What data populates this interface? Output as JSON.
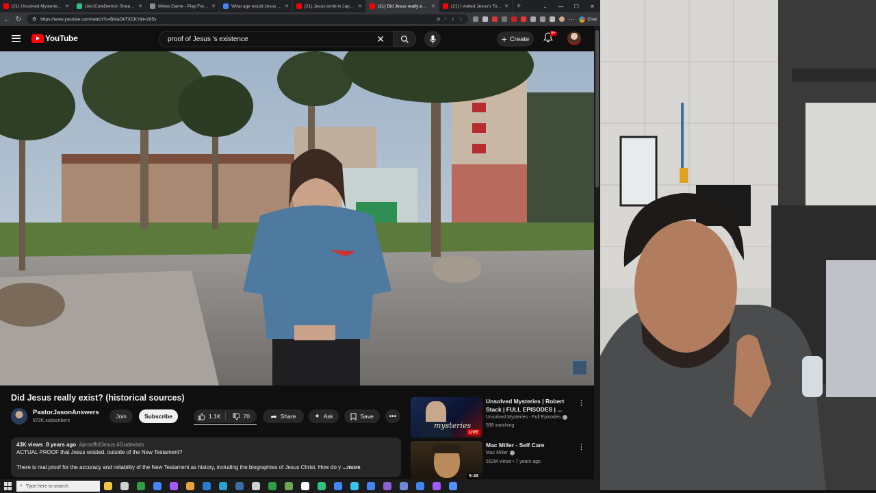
{
  "browser": {
    "tabs": [
      {
        "title": "(21) Unsolved Mysteries | Rob",
        "color": "#ff0000",
        "active": false
      },
      {
        "title": "UwUCuteDemon Stream - Wa",
        "color": "#2ec27e",
        "active": false
      },
      {
        "title": "Mines Game - Play Free Social",
        "color": "#8a8a8a",
        "active": false
      },
      {
        "title": "What age would Jesus have liv",
        "color": "#4285f4",
        "active": false
      },
      {
        "title": "(21) Jesus tomb in Japan - Yo",
        "color": "#ff0000",
        "active": false
      },
      {
        "title": "(21) Did Jesus really exist? (h",
        "color": "#ff0000",
        "active": true
      },
      {
        "title": "(21) I visited Jesus's Tomb in",
        "color": "#ff0000",
        "active": false
      }
    ],
    "url": "https://www.youtube.com/watch?v=BbIaOkTXCKY&t=285s",
    "chat_label": "Chat"
  },
  "youtube": {
    "logo_text": "YouTube",
    "search_query": "proof of Jesus 's existence",
    "create_label": "Create",
    "notif_badge": "9+",
    "video": {
      "title": "Did Jesus really exist? (historical sources)",
      "channel": "PastorJasonAnswers",
      "subscribers": "872K subscribers",
      "join_label": "Join",
      "subscribe_label": "Subscribe",
      "likes": "1.1K",
      "dislikes": "70",
      "share_label": "Share",
      "ask_label": "Ask",
      "save_label": "Save",
      "views": "43K views",
      "age": "8 years ago",
      "tags": "#prooffofJesus #Godexists",
      "desc_line1": "ACTUAL PROOF that Jesus existed, outside of the New Testament?",
      "desc_line2": "There is real proof for the accuracy and reliability of the New Testament as history, including the biographies of Jesus Christ. How do y",
      "more_label": "...more"
    },
    "recommendations": [
      {
        "title": "Unsolved Mysteries | Robert Stack | FULL EPISODES | ...",
        "channel": "Unsolved Mysteries - Full Episodes",
        "stats": "598 watching",
        "badge": "LIVE",
        "thumb_text": "mysteries"
      },
      {
        "title": "Mac Miller - Self Care",
        "channel": "Mac Miller",
        "stats": "552M views • 7 years ago",
        "badge": "5:48",
        "thumb_text": ""
      }
    ]
  },
  "taskbar": {
    "search_placeholder": "Type here to search",
    "app_colors": [
      "#f5c542",
      "#d0d0d0",
      "#2ea043",
      "#4285f4",
      "#a259ff",
      "#e8a33d",
      "#2b7cd3",
      "#2b9fd3",
      "#3a6ea5",
      "#d0d0d0",
      "#2ea043",
      "#6aa84f",
      "#ffffff",
      "#2ec27e",
      "#4285f4",
      "#36c5f0",
      "#4285f4",
      "#8a63d2",
      "#7289da",
      "#4285f4",
      "#a259ff",
      "#4d90fe"
    ]
  }
}
